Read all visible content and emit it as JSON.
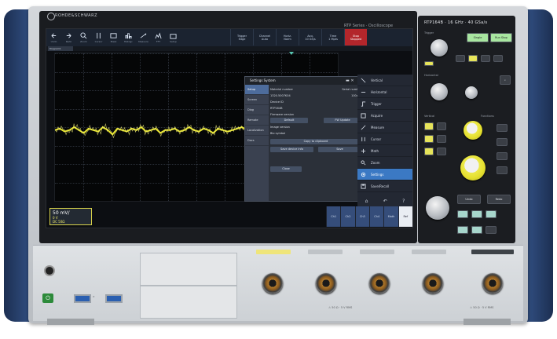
{
  "device": {
    "brand": "ROHDE&SCHWARZ",
    "series_label": "RTP Series · Oscilloscope",
    "model_label": "RTP164B · 16 GHz · 40 GSa/s"
  },
  "toolbar": {
    "buttons": [
      "Undo",
      "Redo",
      "Zoom",
      "Cursor",
      "Mask",
      "Histogr.",
      "Measure",
      "FFT",
      "Setup"
    ],
    "right": [
      {
        "label": "Trigger",
        "value": "Edge"
      },
      {
        "label": "Channel",
        "value": "Auto"
      },
      {
        "label": "Horiz.",
        "value": "Norm"
      },
      {
        "label": "Acq.",
        "value": "10 GS/s"
      },
      {
        "label": "Time",
        "value": "1 Mpts"
      },
      {
        "label": "Stop",
        "value": "Stopped"
      }
    ]
  },
  "screen": {
    "tab_label": "Diagram1",
    "y_labels": [
      "",
      "",
      "",
      "",
      "",
      "",
      "",
      "",
      ""
    ],
    "time_labels": [
      "",
      "",
      "",
      "",
      "",
      "",
      "",
      ""
    ],
    "ch1": {
      "label": "Ch1",
      "scale": "50 mV/",
      "offset": "0 V",
      "coupling": "DC 50Ω"
    }
  },
  "dialog": {
    "title": "Settings System",
    "side": [
      "Setup",
      "Screen",
      "Diag",
      "Remote",
      "Localization",
      "Docs"
    ],
    "rows": [
      {
        "k": "Material number",
        "v": "Serial number"
      },
      {
        "k": "1320.5007K04",
        "v": "100xxx"
      },
      {
        "k": "Device ID",
        "v": ""
      },
      {
        "k": "RTP164B",
        "v": ""
      },
      {
        "k": "Firmware version",
        "v": ""
      },
      {
        "k": "Default",
        "v": "FW Update"
      },
      {
        "k": "Image version",
        "v": ""
      },
      {
        "k": "Bio symbol",
        "v": ""
      },
      {
        "k": "Copy to clipboard",
        "v": ""
      }
    ],
    "buttons": [
      "Save device info",
      "Save",
      "Close"
    ]
  },
  "menu": {
    "items": [
      "Vertical",
      "Horizontal",
      "Trigger",
      "Acquire",
      "Measure",
      "Cursor",
      "Math",
      "Zoom",
      "Settings",
      "Save/Recall"
    ],
    "active_index": 8
  },
  "quick": [
    "Ch1",
    "Ch2",
    "Ch3",
    "Ch4",
    "Math",
    "Ref"
  ],
  "panel": {
    "sections": [
      "Trigger",
      "Horizontal",
      "Vertical",
      "Functions"
    ],
    "buttons": [
      "Single",
      "Run Stop",
      "Auto",
      "Setup",
      "Undo",
      "Redo",
      "Menu",
      "Touch"
    ]
  },
  "front": {
    "channels": [
      "",
      "",
      "",
      ""
    ],
    "warn": "⚠ 50 Ω · 5 V RMS"
  },
  "colors": {
    "trace": "#e8e52e",
    "accent": "#3b79c4",
    "chassis_blue": "#2e4a7a"
  },
  "trace": [
    52,
    51,
    53,
    52,
    50,
    52,
    54,
    51,
    52,
    53,
    50,
    52,
    55,
    51,
    52,
    53,
    51,
    52,
    50,
    53,
    52,
    51,
    54,
    52,
    52,
    51,
    53,
    52,
    50,
    52,
    53,
    51,
    52,
    54,
    51,
    52,
    53,
    52,
    51,
    50,
    52,
    53,
    52,
    51,
    54,
    52,
    52,
    53,
    51,
    52,
    50,
    53,
    52,
    51,
    52,
    54,
    52,
    51,
    53,
    52
  ]
}
